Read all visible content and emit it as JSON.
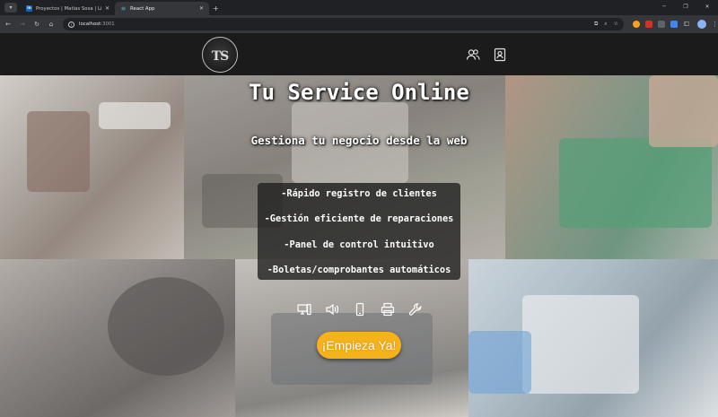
{
  "browser": {
    "tabs": [
      {
        "title": "Proyectos | Matias Sosa | Linke",
        "icon": "linkedin-icon",
        "active": false
      },
      {
        "title": "React App",
        "icon": "react-icon",
        "active": true
      }
    ],
    "new_tab": "+",
    "url_host": "localhost",
    "url_port": ":3001"
  },
  "header": {
    "logo_text": "TS",
    "icons": [
      "users-icon",
      "contact-card-icon"
    ]
  },
  "hero": {
    "title": "Tu Service Online",
    "subtitle": "Gestiona tu negocio desde la web"
  },
  "features": [
    "-Rápido registro de clientes",
    "-Gestión eficiente de reparaciones",
    "-Panel de control intuitivo",
    "-Boletas/comprobantes automáticos"
  ],
  "device_icons": [
    "computer-icon",
    "speaker-icon",
    "smartphone-icon",
    "printer-icon",
    "wrench-icon"
  ],
  "cta": {
    "label": "¡Empieza Ya!",
    "color": "#f6b21b"
  },
  "colors": {
    "header_bg": "#1b1b1b",
    "accent": "#f6b21b",
    "feature_box": "#1e1e1e"
  }
}
